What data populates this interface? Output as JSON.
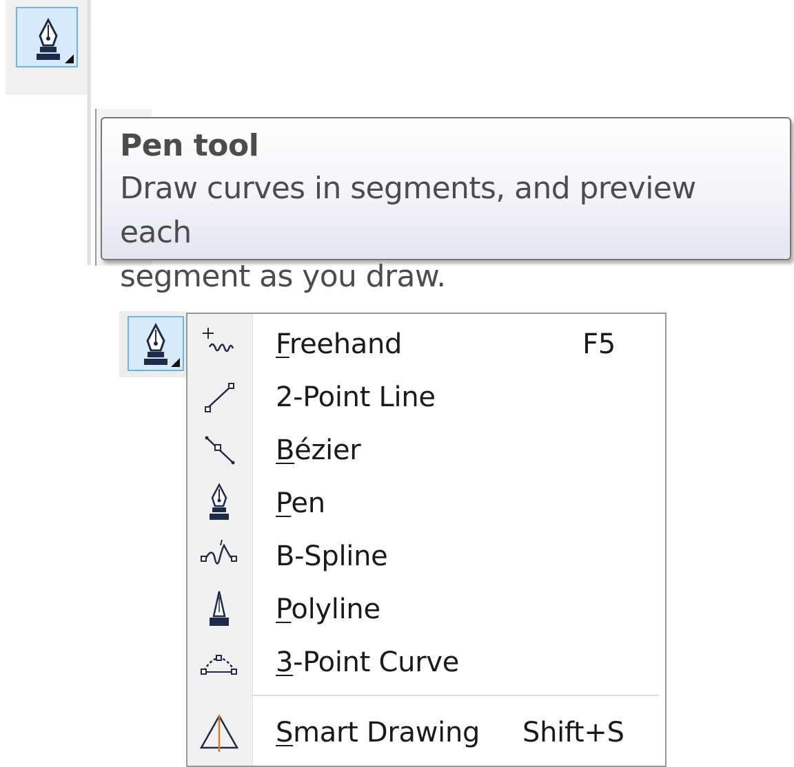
{
  "toolbar": {
    "tool_icon": "pen-nib-icon"
  },
  "tooltip": {
    "title": "Pen tool",
    "description_line1": "Draw curves in segments, and preview each",
    "description_line2": "segment as you draw."
  },
  "flyout": {
    "tool_icon": "pen-nib-icon",
    "items": [
      {
        "mnemonic": "F",
        "rest": "reehand",
        "shortcut": "F5",
        "icon": "freehand-icon"
      },
      {
        "mnemonic": "",
        "rest": "2-Point Line",
        "shortcut": "",
        "icon": "two-point-line-icon"
      },
      {
        "mnemonic": "B",
        "rest": "ézier",
        "shortcut": "",
        "icon": "bezier-icon"
      },
      {
        "mnemonic": "P",
        "rest": "en",
        "shortcut": "",
        "icon": "pen-nib-icon"
      },
      {
        "mnemonic": "",
        "rest": "B-Spline",
        "shortcut": "",
        "icon": "b-spline-icon"
      },
      {
        "mnemonic": "P",
        "rest": "olyline",
        "shortcut": "",
        "icon": "polyline-icon"
      },
      {
        "mnemonic": "3",
        "rest": "-Point Curve",
        "shortcut": "",
        "icon": "three-point-curve-icon"
      },
      {
        "mnemonic": "S",
        "rest": "mart Drawing",
        "shortcut": "Shift+S",
        "icon": "smart-drawing-icon"
      }
    ]
  },
  "colors": {
    "selected_button_bg": "#d6ebfb",
    "selected_button_border": "#6fb3ea",
    "icon_dark": "#1f2a4a",
    "smart_drawing_accent": "#e07a1f"
  }
}
